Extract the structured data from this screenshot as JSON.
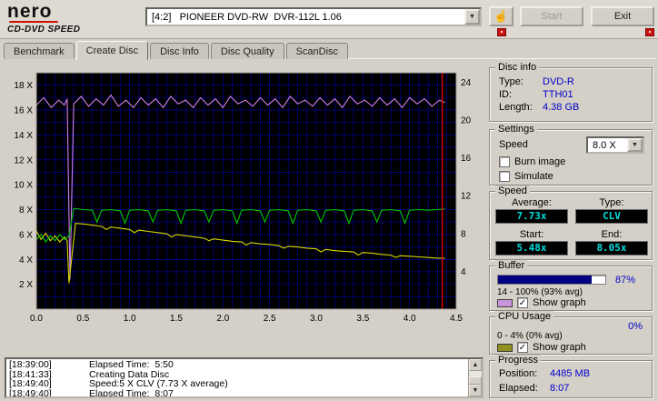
{
  "icons": {
    "hand": "☝",
    "dropdown": "▼",
    "check": "✓",
    "scroll_up": "▲",
    "scroll_down": "▼"
  },
  "header": {
    "brand": {
      "name": "nero",
      "sub": "CD-DVD SPEED"
    },
    "drive_select": {
      "value": "[4:2]   PIONEER DVD-RW  DVR-112L 1.06"
    },
    "start_label": "Start",
    "exit_label": "Exit"
  },
  "tabs": {
    "items": [
      {
        "label": "Benchmark",
        "active": false
      },
      {
        "label": "Create Disc",
        "active": true
      },
      {
        "label": "Disc Info",
        "active": false
      },
      {
        "label": "Disc Quality",
        "active": false
      },
      {
        "label": "ScanDisc",
        "active": false
      }
    ]
  },
  "chart_data": {
    "type": "line",
    "title": "",
    "xlabel": "",
    "ylabel": "",
    "x_range": [
      0,
      4.5
    ],
    "x_ticks": [
      0,
      0.5,
      1,
      1.5,
      2,
      2.5,
      3,
      3.5,
      4,
      4.5
    ],
    "y_left": {
      "max": 19,
      "ticks": [
        2,
        4,
        6,
        8,
        10,
        12,
        14,
        16,
        18
      ],
      "suffix": " X"
    },
    "y_right": {
      "ticks": [
        4,
        8,
        12,
        16,
        20,
        24
      ],
      "scale": 0.76
    },
    "grid": {
      "x_step": 0.1,
      "y_step": 1,
      "color": "#0000ac",
      "background": "#000000"
    },
    "marker_x": 4.35,
    "marker_color": "#e00000",
    "legend_position": "none",
    "series": [
      {
        "name": "buffer-level",
        "color": "#cf80e8",
        "points": [
          [
            0,
            16.4
          ],
          [
            0.08,
            17.0
          ],
          [
            0.16,
            16.2
          ],
          [
            0.24,
            16.8
          ],
          [
            0.3,
            16.4
          ],
          [
            0.33,
            16.9
          ],
          [
            0.36,
            2.4
          ],
          [
            0.4,
            16.5
          ],
          [
            0.48,
            17.1
          ],
          [
            0.56,
            16.3
          ],
          [
            0.64,
            16.9
          ],
          [
            0.72,
            16.4
          ],
          [
            0.8,
            17.2
          ],
          [
            0.88,
            16.3
          ],
          [
            0.96,
            16.8
          ],
          [
            1.04,
            16.2
          ],
          [
            1.12,
            17.0
          ],
          [
            1.2,
            16.4
          ],
          [
            1.28,
            16.9
          ],
          [
            1.36,
            16.2
          ],
          [
            1.44,
            17.1
          ],
          [
            1.52,
            16.5
          ],
          [
            1.6,
            16.8
          ],
          [
            1.68,
            16.2
          ],
          [
            1.76,
            17.0
          ],
          [
            1.84,
            16.4
          ],
          [
            1.92,
            16.9
          ],
          [
            2.0,
            16.2
          ],
          [
            2.08,
            17.1
          ],
          [
            2.16,
            16.5
          ],
          [
            2.24,
            16.8
          ],
          [
            2.32,
            16.3
          ],
          [
            2.4,
            17.0
          ],
          [
            2.48,
            16.4
          ],
          [
            2.56,
            16.9
          ],
          [
            2.64,
            16.2
          ],
          [
            2.72,
            17.1
          ],
          [
            2.8,
            16.5
          ],
          [
            2.88,
            16.8
          ],
          [
            2.96,
            16.3
          ],
          [
            3.04,
            17.0
          ],
          [
            3.12,
            16.4
          ],
          [
            3.2,
            16.9
          ],
          [
            3.28,
            16.2
          ],
          [
            3.36,
            17.1
          ],
          [
            3.44,
            16.5
          ],
          [
            3.52,
            16.8
          ],
          [
            3.6,
            16.3
          ],
          [
            3.68,
            17.0
          ],
          [
            3.76,
            16.4
          ],
          [
            3.84,
            16.9
          ],
          [
            3.92,
            16.2
          ],
          [
            4.0,
            17.0
          ],
          [
            4.08,
            16.5
          ],
          [
            4.16,
            16.9
          ],
          [
            4.24,
            16.3
          ],
          [
            4.32,
            16.8
          ],
          [
            4.38,
            16.6
          ]
        ]
      },
      {
        "name": "rotation-speed",
        "color": "#d8d800",
        "points": [
          [
            0,
            6.3
          ],
          [
            0.05,
            5.6
          ],
          [
            0.1,
            6.1
          ],
          [
            0.15,
            5.5
          ],
          [
            0.2,
            5.9
          ],
          [
            0.25,
            5.4
          ],
          [
            0.3,
            5.8
          ],
          [
            0.33,
            5.5
          ],
          [
            0.35,
            2.1
          ],
          [
            0.42,
            6.9
          ],
          [
            0.5,
            6.85
          ],
          [
            0.6,
            6.75
          ],
          [
            0.7,
            6.65
          ],
          [
            0.75,
            6.4
          ],
          [
            0.8,
            6.6
          ],
          [
            0.9,
            6.5
          ],
          [
            1.0,
            6.4
          ],
          [
            1.05,
            6.15
          ],
          [
            1.1,
            6.35
          ],
          [
            1.2,
            6.25
          ],
          [
            1.3,
            6.15
          ],
          [
            1.4,
            6.05
          ],
          [
            1.45,
            5.8
          ],
          [
            1.5,
            6.0
          ],
          [
            1.6,
            5.9
          ],
          [
            1.7,
            5.8
          ],
          [
            1.8,
            5.7
          ],
          [
            1.85,
            5.5
          ],
          [
            1.9,
            5.65
          ],
          [
            2.0,
            5.55
          ],
          [
            2.1,
            5.45
          ],
          [
            2.2,
            5.4
          ],
          [
            2.25,
            5.15
          ],
          [
            2.3,
            5.35
          ],
          [
            2.4,
            5.25
          ],
          [
            2.5,
            5.2
          ],
          [
            2.6,
            5.1
          ],
          [
            2.65,
            4.9
          ],
          [
            2.7,
            5.05
          ],
          [
            2.8,
            5.0
          ],
          [
            2.9,
            4.9
          ],
          [
            3.0,
            4.85
          ],
          [
            3.05,
            4.6
          ],
          [
            3.1,
            4.8
          ],
          [
            3.2,
            4.7
          ],
          [
            3.3,
            4.65
          ],
          [
            3.4,
            4.6
          ],
          [
            3.45,
            4.35
          ],
          [
            3.5,
            4.55
          ],
          [
            3.6,
            4.5
          ],
          [
            3.7,
            4.4
          ],
          [
            3.8,
            4.35
          ],
          [
            3.85,
            4.15
          ],
          [
            3.9,
            4.3
          ],
          [
            4.0,
            4.25
          ],
          [
            4.1,
            4.2
          ],
          [
            4.2,
            4.15
          ],
          [
            4.3,
            4.1
          ],
          [
            4.38,
            4.1
          ]
        ]
      },
      {
        "name": "write-speed",
        "color": "#00c800",
        "points": [
          [
            0,
            5.6
          ],
          [
            0.05,
            6.0
          ],
          [
            0.1,
            5.4
          ],
          [
            0.15,
            5.9
          ],
          [
            0.2,
            5.5
          ],
          [
            0.25,
            6.0
          ],
          [
            0.3,
            5.6
          ],
          [
            0.35,
            5.9
          ],
          [
            0.4,
            8.1
          ],
          [
            0.5,
            8.0
          ],
          [
            0.6,
            7.95
          ],
          [
            0.65,
            7.0
          ],
          [
            0.7,
            7.95
          ],
          [
            0.8,
            8.0
          ],
          [
            0.9,
            7.9
          ],
          [
            0.95,
            6.9
          ],
          [
            1.0,
            7.95
          ],
          [
            1.1,
            8.0
          ],
          [
            1.2,
            7.9
          ],
          [
            1.25,
            7.0
          ],
          [
            1.3,
            7.95
          ],
          [
            1.4,
            8.0
          ],
          [
            1.5,
            7.9
          ],
          [
            1.55,
            6.9
          ],
          [
            1.6,
            7.95
          ],
          [
            1.7,
            8.0
          ],
          [
            1.8,
            7.9
          ],
          [
            1.85,
            7.0
          ],
          [
            1.9,
            7.95
          ],
          [
            2.0,
            8.0
          ],
          [
            2.1,
            7.9
          ],
          [
            2.15,
            6.9
          ],
          [
            2.2,
            7.95
          ],
          [
            2.3,
            8.0
          ],
          [
            2.4,
            7.9
          ],
          [
            2.45,
            7.0
          ],
          [
            2.5,
            7.95
          ],
          [
            2.6,
            8.0
          ],
          [
            2.7,
            7.9
          ],
          [
            2.75,
            6.9
          ],
          [
            2.8,
            7.95
          ],
          [
            2.9,
            8.0
          ],
          [
            3.0,
            7.9
          ],
          [
            3.05,
            7.0
          ],
          [
            3.1,
            7.95
          ],
          [
            3.2,
            8.0
          ],
          [
            3.3,
            7.9
          ],
          [
            3.35,
            6.9
          ],
          [
            3.4,
            7.95
          ],
          [
            3.5,
            8.0
          ],
          [
            3.6,
            7.9
          ],
          [
            3.65,
            7.0
          ],
          [
            3.7,
            7.95
          ],
          [
            3.8,
            8.0
          ],
          [
            3.9,
            7.9
          ],
          [
            3.95,
            6.9
          ],
          [
            4.0,
            7.95
          ],
          [
            4.1,
            8.0
          ],
          [
            4.2,
            7.95
          ],
          [
            4.3,
            8.0
          ],
          [
            4.38,
            8.05
          ]
        ]
      }
    ]
  },
  "panel": {
    "disc_info": {
      "title": "Disc info",
      "rows": [
        {
          "label": "Type:",
          "value": "DVD-R"
        },
        {
          "label": "ID:",
          "value": "TTH01"
        },
        {
          "label": "Length:",
          "value": "4.38 GB"
        }
      ]
    },
    "settings": {
      "title": "Settings",
      "speed_label": "Speed",
      "speed_value": "8.0 X",
      "checkboxes": [
        {
          "label": "Burn image",
          "checked": false
        },
        {
          "label": "Simulate",
          "checked": false
        }
      ]
    },
    "speed": {
      "title": "Speed",
      "average_label": "Average:",
      "average_value": "7.73x",
      "type_label": "Type:",
      "type_value": "CLV",
      "start_label": "Start:",
      "start_value": "5.48x",
      "end_label": "End:",
      "end_value": "8.05x"
    },
    "buffer": {
      "title": "Buffer",
      "percent": 87,
      "percent_label": "87%",
      "fill": "#000080",
      "range": "14 - 100% (93% avg)",
      "show_graph_label": "Show graph",
      "checked": true,
      "swatch": "#c993dd"
    },
    "cpu": {
      "title": "CPU Usage",
      "percent_label": "0%",
      "range": "0 - 4% (0% avg)",
      "show_graph_label": "Show graph",
      "checked": true,
      "swatch": "#8f8f22"
    },
    "progress": {
      "title": "Progress",
      "position_label": "Position:",
      "position_value": "4485 MB",
      "elapsed_label": "Elapsed:",
      "elapsed_value": "8:07"
    }
  },
  "log": {
    "lines": [
      {
        "time": "[18:39:00]",
        "text": "Elapsed Time:  5:50"
      },
      {
        "time": "[18:41:33]",
        "text": "Creating Data Disc"
      },
      {
        "time": "[18:49:40]",
        "text": "Speed:5 X CLV (7.73 X average)"
      },
      {
        "time": "[18:49:40]",
        "text": "Elapsed Time:  8:07"
      }
    ]
  }
}
